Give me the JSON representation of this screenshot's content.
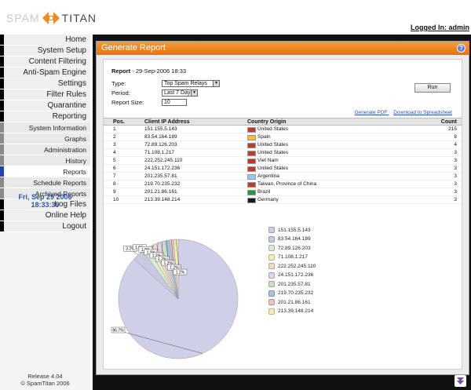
{
  "brand": {
    "word1": "SPAM",
    "word2": "TITAN"
  },
  "header": {
    "logged_in": "Logged In: admin"
  },
  "nav": [
    {
      "label": "Home",
      "sub": false
    },
    {
      "label": "System Setup",
      "sub": false
    },
    {
      "label": "Content Filtering",
      "sub": false
    },
    {
      "label": "Anti-Spam Engine",
      "sub": false
    },
    {
      "label": "Settings",
      "sub": false
    },
    {
      "label": "Filter Rules",
      "sub": false
    },
    {
      "label": "Quarantine",
      "sub": false
    },
    {
      "label": "Reporting",
      "sub": false
    },
    {
      "label": "System Information",
      "sub": true
    },
    {
      "label": "Graphs",
      "sub": true
    },
    {
      "label": "Administration",
      "sub": true
    },
    {
      "label": "History",
      "sub": true
    },
    {
      "label": "Reports",
      "sub": true,
      "active": true
    },
    {
      "label": "Schedule Reports",
      "sub": true
    },
    {
      "label": "Archived Reports",
      "sub": true
    },
    {
      "label": "Log Files",
      "sub": false
    },
    {
      "label": "Online Help",
      "sub": false
    },
    {
      "label": "Logout",
      "sub": false
    }
  ],
  "clock": {
    "date": "Fri, Sep 29 2006",
    "time": "18:33:39"
  },
  "release": {
    "version": "Release 4.04",
    "copyright": "© SpamTitan 2006"
  },
  "panel": {
    "title": "Generate Report",
    "report_label": "Report",
    "report_date": " - 29-Sep-2006 18:33",
    "type_label": "Type:",
    "type_value": "Top Spam Relays",
    "period_label": "Period:",
    "period_value": "Last 7 Days",
    "size_label": "Report Size:",
    "size_value": "10",
    "run_label": "Run",
    "generate_pdf": "Generate PDF",
    "download": "Download to Spreadsheet"
  },
  "table": {
    "headers": {
      "pos": "Pos.",
      "ip": "Client IP Address",
      "origin": "Country Origin",
      "count": "Count"
    },
    "rows": [
      {
        "pos": "1",
        "ip": "151.155.5.143",
        "origin": "United States",
        "count": "215",
        "flag": "us"
      },
      {
        "pos": "2",
        "ip": "83.54.164.189",
        "origin": "Spain",
        "count": "8",
        "flag": "es"
      },
      {
        "pos": "3",
        "ip": "72.89.126.203",
        "origin": "United States",
        "count": "4",
        "flag": "us"
      },
      {
        "pos": "4",
        "ip": "71.108.1.217",
        "origin": "United States",
        "count": "3",
        "flag": "us"
      },
      {
        "pos": "5",
        "ip": "222.252.245.110",
        "origin": "Viet Nam",
        "count": "3",
        "flag": "vn"
      },
      {
        "pos": "6",
        "ip": "24.151.172.236",
        "origin": "United States",
        "count": "3",
        "flag": "us"
      },
      {
        "pos": "7",
        "ip": "201.235.57.81",
        "origin": "Argentina",
        "count": "3",
        "flag": "ar"
      },
      {
        "pos": "8",
        "ip": "219.70.235.232",
        "origin": "Taiwan, Province of China",
        "count": "3",
        "flag": "tw"
      },
      {
        "pos": "9",
        "ip": "201.21.86.161",
        "origin": "Brazil",
        "count": "3",
        "flag": "br"
      },
      {
        "pos": "10",
        "ip": "213.39.148.214",
        "origin": "Germany",
        "count": "3",
        "flag": "de"
      }
    ]
  },
  "chart_data": {
    "type": "pie",
    "title": "",
    "categories": [
      "151.155.5.143",
      "83.54.164.189",
      "72.89.126.203",
      "71.108.1.217",
      "222.252.245.110",
      "24.151.172.236",
      "201.235.57.81",
      "219.70.235.232",
      "201.21.86.161",
      "213.39.148.214"
    ],
    "values": [
      215,
      8,
      4,
      3,
      3,
      3,
      3,
      3,
      3,
      3
    ],
    "slice_labels": [
      "86.7%",
      "3.2%",
      "1.6%",
      "1.2%",
      "1.2%",
      "1.2%",
      "1.2%",
      "1.2%",
      "1.2%",
      "1.2%"
    ],
    "colors": [
      "#cfcfe8",
      "#c9c9e2",
      "#d7ecd6",
      "#f5ecb9",
      "#f3dcc6",
      "#e3d3e7",
      "#c9e1c1",
      "#a7c3de",
      "#eac4c4",
      "#f0efb4"
    ],
    "legend_placement": "right"
  },
  "flags": {
    "us": "#c0392b",
    "es": "#f1c40f",
    "vn": "#d62d20",
    "ar": "#8ecbf0",
    "tw": "#c0392b",
    "br": "#1e9b3a",
    "de": "#1a1a1a"
  },
  "colors": {
    "accent": "#f08a24",
    "nav_active": "#1c45a6",
    "link": "#2d4fbf"
  }
}
